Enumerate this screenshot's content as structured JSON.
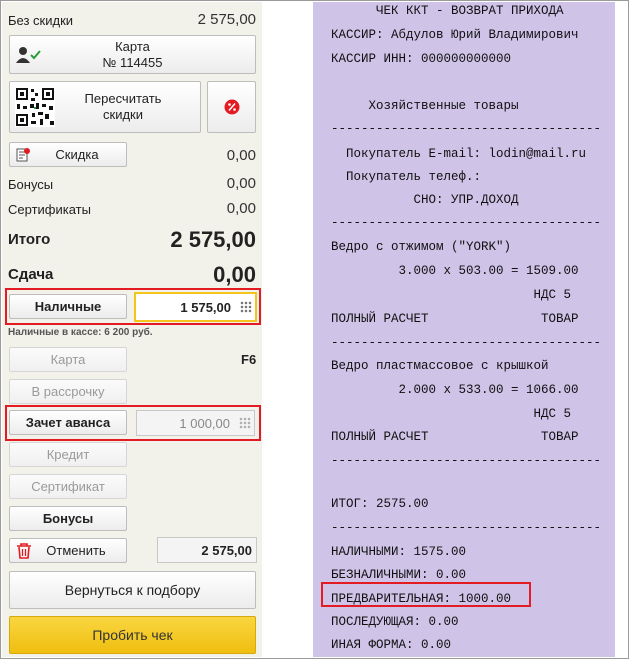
{
  "pos": {
    "no_discount_label": "Без скидки",
    "no_discount_value": "2 575,00",
    "card_button": {
      "line1": "Карта",
      "line2": "№ 114455"
    },
    "recalc_button": {
      "line1": "Пересчитать",
      "line2": "скидки"
    },
    "discount_button": "Скидка",
    "discount_value": "0,00",
    "bonuses_label": "Бонусы",
    "bonuses_value": "0,00",
    "certificates_label": "Сертификаты",
    "certificates_value": "0,00",
    "total_label": "Итого",
    "total_value": "2 575,00",
    "change_label": "Сдача",
    "change_value": "0,00",
    "cash_button": "Наличные",
    "cash_input": "1 575,00",
    "cash_in_register": "Наличные в кассе: 6 200 руб.",
    "card_pay_button": "Карта",
    "card_pay_hotkey": "F6",
    "installment_button": "В рассрочку",
    "advance_button": "Зачет аванса",
    "advance_input": "1 000,00",
    "credit_button": "Кредит",
    "certificate_button": "Сертификат",
    "bonus_button": "Бонусы",
    "cancel_button": "Отменить",
    "cancel_total": "2 575,00",
    "back_button": "Вернуться к подбору",
    "print_button": "Пробить чек"
  },
  "receipt": {
    "lines": [
      "      ЧЕК ККТ - ВОЗВРАТ ПРИХОДА",
      "КАССИР: Абдулов Юрий Владимирович",
      "КАССИР ИНН: 000000000000",
      "",
      "     Хозяйственные товары",
      "------------------------------------",
      "  Покупатель E-mail: lodin@mail.ru",
      "  Покупатель телеф.:",
      "           СНО: УПР.ДОХОД",
      "------------------------------------",
      "Ведро с отжимом (\"YORK\")",
      "         3.000 x 503.00 = 1509.00",
      "                           НДС 5",
      "ПОЛНЫЙ РАСЧЕТ               ТОВАР",
      "------------------------------------",
      "Ведро пластмассовое с крышкой",
      "         2.000 x 533.00 = 1066.00",
      "                           НДС 5",
      "ПОЛНЫЙ РАСЧЕТ               ТОВАР",
      "------------------------------------",
      "ИТОГ: 2575.00",
      "------------------------------------",
      "НАЛИЧНЫМИ: 1575.00",
      "БЕЗНАЛИЧНЫМИ: 0.00",
      "ПРЕДВАРИТЕЛЬНАЯ: 1000.00",
      "ПОСЛЕДУЮЩАЯ: 0.00",
      "ИНАЯ ФОРМА: 0.00"
    ]
  },
  "colors": {
    "highlight": "#e31b23",
    "receipt_bg": "#cfc3e8",
    "print_button": "#f5c51c",
    "panel_bg": "#f2f1ea"
  },
  "icons": [
    "user-check-icon",
    "qr-code-icon",
    "percent-icon",
    "discount-icon",
    "keypad-icon",
    "trash-icon"
  ]
}
